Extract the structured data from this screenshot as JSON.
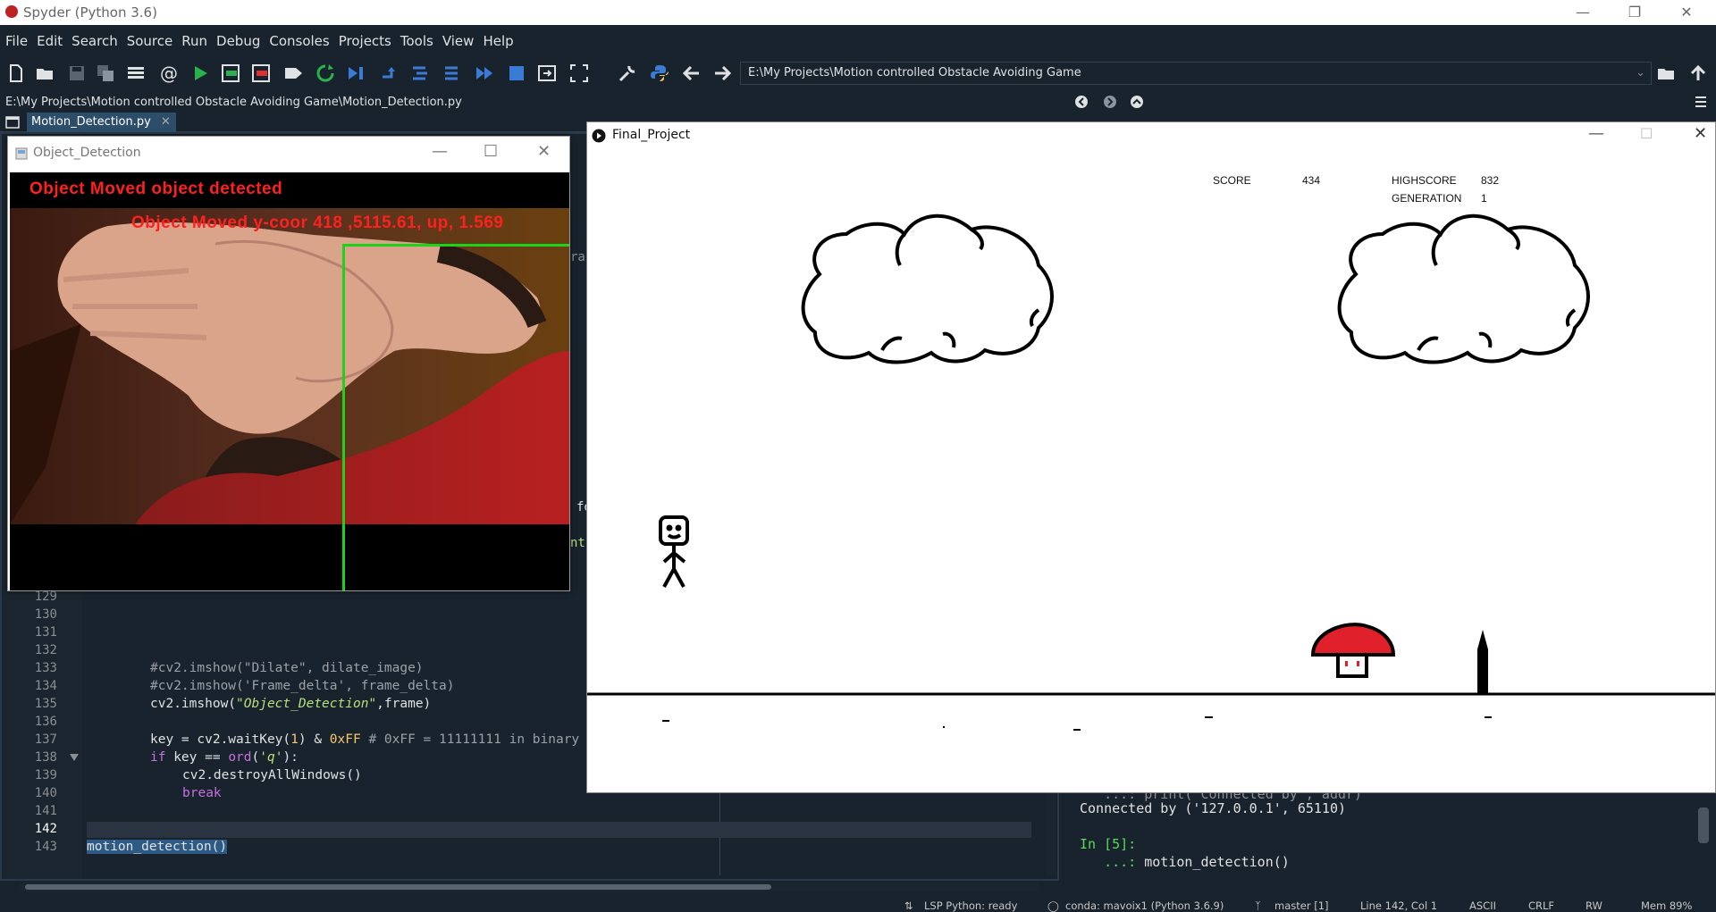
{
  "window": {
    "title": "Spyder (Python 3.6)"
  },
  "menu": [
    "File",
    "Edit",
    "Search",
    "Source",
    "Run",
    "Debug",
    "Consoles",
    "Projects",
    "Tools",
    "View",
    "Help"
  ],
  "toolbar": {
    "path": "E:\\My Projects\\Motion controlled Obstacle Avoiding Game"
  },
  "editor": {
    "file_path": "E:\\My Projects\\Motion controlled Obstacle Avoiding Game\\Motion_Detection.py",
    "tab_label": "Motion_Detection.py",
    "line_numbers": [
      "129",
      "130",
      "131",
      "132",
      "133",
      "134",
      "135",
      "136",
      "137",
      "138",
      "139",
      "140",
      "141",
      "142",
      "143"
    ],
    "lines": {
      "l133": "#cv2.imshow(\"Dilate\", dilate_image)",
      "l134": "#cv2.imshow('Frame_delta', frame_delta)",
      "l135a": "cv2.imshow(",
      "l135b": "\"Object_Detection\"",
      "l135c": ",frame)",
      "l137a": "key = cv2.waitKey(",
      "l137b": "1",
      "l137c": ") & ",
      "l137d": "0xFF",
      "l137e": " # 0xFF = 11111111 in binary",
      "l138a": "if",
      "l138b": " key == ",
      "l138c": "ord",
      "l138d": "(",
      "l138e": "'q'",
      "l138f": "):",
      "l139": "cv2.destroyAllWindows()",
      "l140": "break",
      "l143": "motion_detection()"
    },
    "peek": {
      "p1": "rac",
      "p2": "fo",
      "p3": "nti"
    }
  },
  "console": {
    "line1": "   ...: print('Connected by', addr)",
    "line2": "Connected by ('127.0.0.1', 65110)",
    "prompt": "In [5]:",
    "cont": "   ...: ",
    "cmd": "motion_detection()"
  },
  "object_window": {
    "title": "Object_Detection",
    "text1": "Object Moved object detected",
    "text2": "Object Moved y-coor 418 ,5115.61, up, 1.569"
  },
  "game_window": {
    "title": "Final_Project",
    "score_label": "SCORE",
    "score": "434",
    "highscore_label": "HIGHSCORE",
    "highscore": "832",
    "generation_label": "GENERATION",
    "generation": "1"
  },
  "statusbar": {
    "lsp": "LSP Python: ready",
    "conda": "conda: mavoix1 (Python 3.6.9)",
    "git": "master [1]",
    "position": "Line 142, Col 1",
    "encoding": "ASCII",
    "eol": "CRLF",
    "rw": "RW",
    "mem": "Mem 89%"
  }
}
